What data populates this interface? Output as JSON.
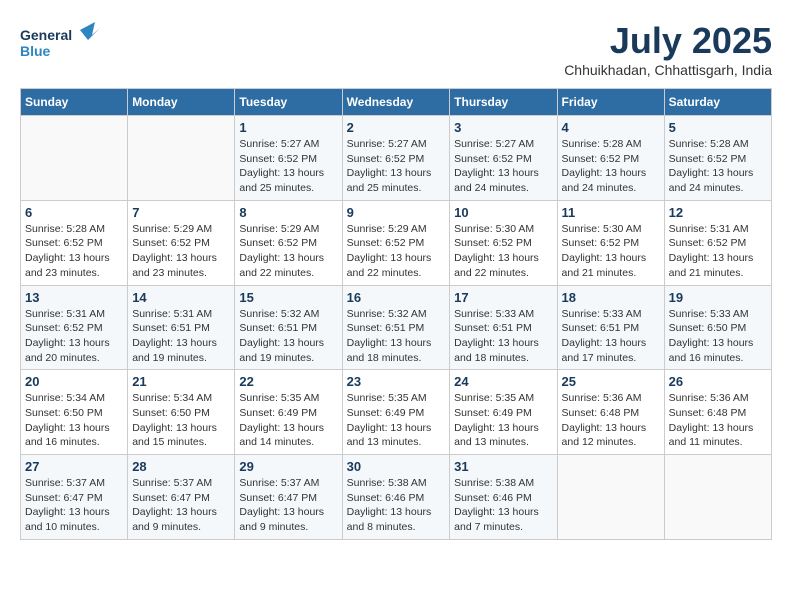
{
  "header": {
    "logo_line1": "General",
    "logo_line2": "Blue",
    "month_year": "July 2025",
    "location": "Chhuikhadan, Chhattisgarh, India"
  },
  "days_of_week": [
    "Sunday",
    "Monday",
    "Tuesday",
    "Wednesday",
    "Thursday",
    "Friday",
    "Saturday"
  ],
  "weeks": [
    [
      {
        "day": "",
        "info": ""
      },
      {
        "day": "",
        "info": ""
      },
      {
        "day": "1",
        "info": "Sunrise: 5:27 AM\nSunset: 6:52 PM\nDaylight: 13 hours\nand 25 minutes."
      },
      {
        "day": "2",
        "info": "Sunrise: 5:27 AM\nSunset: 6:52 PM\nDaylight: 13 hours\nand 25 minutes."
      },
      {
        "day": "3",
        "info": "Sunrise: 5:27 AM\nSunset: 6:52 PM\nDaylight: 13 hours\nand 24 minutes."
      },
      {
        "day": "4",
        "info": "Sunrise: 5:28 AM\nSunset: 6:52 PM\nDaylight: 13 hours\nand 24 minutes."
      },
      {
        "day": "5",
        "info": "Sunrise: 5:28 AM\nSunset: 6:52 PM\nDaylight: 13 hours\nand 24 minutes."
      }
    ],
    [
      {
        "day": "6",
        "info": "Sunrise: 5:28 AM\nSunset: 6:52 PM\nDaylight: 13 hours\nand 23 minutes."
      },
      {
        "day": "7",
        "info": "Sunrise: 5:29 AM\nSunset: 6:52 PM\nDaylight: 13 hours\nand 23 minutes."
      },
      {
        "day": "8",
        "info": "Sunrise: 5:29 AM\nSunset: 6:52 PM\nDaylight: 13 hours\nand 22 minutes."
      },
      {
        "day": "9",
        "info": "Sunrise: 5:29 AM\nSunset: 6:52 PM\nDaylight: 13 hours\nand 22 minutes."
      },
      {
        "day": "10",
        "info": "Sunrise: 5:30 AM\nSunset: 6:52 PM\nDaylight: 13 hours\nand 22 minutes."
      },
      {
        "day": "11",
        "info": "Sunrise: 5:30 AM\nSunset: 6:52 PM\nDaylight: 13 hours\nand 21 minutes."
      },
      {
        "day": "12",
        "info": "Sunrise: 5:31 AM\nSunset: 6:52 PM\nDaylight: 13 hours\nand 21 minutes."
      }
    ],
    [
      {
        "day": "13",
        "info": "Sunrise: 5:31 AM\nSunset: 6:52 PM\nDaylight: 13 hours\nand 20 minutes."
      },
      {
        "day": "14",
        "info": "Sunrise: 5:31 AM\nSunset: 6:51 PM\nDaylight: 13 hours\nand 19 minutes."
      },
      {
        "day": "15",
        "info": "Sunrise: 5:32 AM\nSunset: 6:51 PM\nDaylight: 13 hours\nand 19 minutes."
      },
      {
        "day": "16",
        "info": "Sunrise: 5:32 AM\nSunset: 6:51 PM\nDaylight: 13 hours\nand 18 minutes."
      },
      {
        "day": "17",
        "info": "Sunrise: 5:33 AM\nSunset: 6:51 PM\nDaylight: 13 hours\nand 18 minutes."
      },
      {
        "day": "18",
        "info": "Sunrise: 5:33 AM\nSunset: 6:51 PM\nDaylight: 13 hours\nand 17 minutes."
      },
      {
        "day": "19",
        "info": "Sunrise: 5:33 AM\nSunset: 6:50 PM\nDaylight: 13 hours\nand 16 minutes."
      }
    ],
    [
      {
        "day": "20",
        "info": "Sunrise: 5:34 AM\nSunset: 6:50 PM\nDaylight: 13 hours\nand 16 minutes."
      },
      {
        "day": "21",
        "info": "Sunrise: 5:34 AM\nSunset: 6:50 PM\nDaylight: 13 hours\nand 15 minutes."
      },
      {
        "day": "22",
        "info": "Sunrise: 5:35 AM\nSunset: 6:49 PM\nDaylight: 13 hours\nand 14 minutes."
      },
      {
        "day": "23",
        "info": "Sunrise: 5:35 AM\nSunset: 6:49 PM\nDaylight: 13 hours\nand 13 minutes."
      },
      {
        "day": "24",
        "info": "Sunrise: 5:35 AM\nSunset: 6:49 PM\nDaylight: 13 hours\nand 13 minutes."
      },
      {
        "day": "25",
        "info": "Sunrise: 5:36 AM\nSunset: 6:48 PM\nDaylight: 13 hours\nand 12 minutes."
      },
      {
        "day": "26",
        "info": "Sunrise: 5:36 AM\nSunset: 6:48 PM\nDaylight: 13 hours\nand 11 minutes."
      }
    ],
    [
      {
        "day": "27",
        "info": "Sunrise: 5:37 AM\nSunset: 6:47 PM\nDaylight: 13 hours\nand 10 minutes."
      },
      {
        "day": "28",
        "info": "Sunrise: 5:37 AM\nSunset: 6:47 PM\nDaylight: 13 hours\nand 9 minutes."
      },
      {
        "day": "29",
        "info": "Sunrise: 5:37 AM\nSunset: 6:47 PM\nDaylight: 13 hours\nand 9 minutes."
      },
      {
        "day": "30",
        "info": "Sunrise: 5:38 AM\nSunset: 6:46 PM\nDaylight: 13 hours\nand 8 minutes."
      },
      {
        "day": "31",
        "info": "Sunrise: 5:38 AM\nSunset: 6:46 PM\nDaylight: 13 hours\nand 7 minutes."
      },
      {
        "day": "",
        "info": ""
      },
      {
        "day": "",
        "info": ""
      }
    ]
  ]
}
